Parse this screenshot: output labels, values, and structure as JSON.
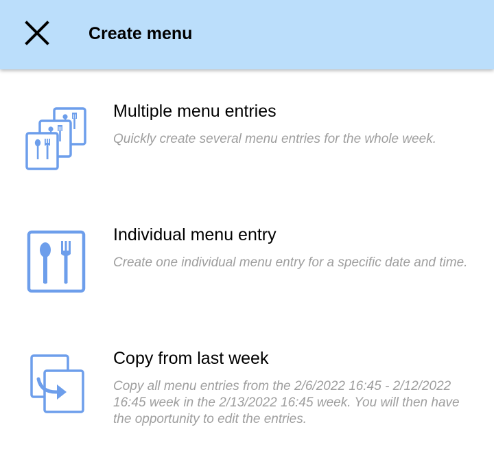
{
  "header": {
    "title": "Create menu",
    "close_icon": "close-icon"
  },
  "colors": {
    "header_bg": "#bbdefb",
    "icon_blue": "#6d9eeb",
    "description_text": "#9e9e9e"
  },
  "options": [
    {
      "title": "Multiple menu entries",
      "description": "Quickly create several menu entries for the whole week.",
      "icon": "multiple-cutlery-cards-icon"
    },
    {
      "title": "Individual menu entry",
      "description": "Create one individual menu entry for a specific date and time.",
      "icon": "cutlery-card-icon"
    },
    {
      "title": "Copy from last week",
      "description": "Copy all menu entries from the 2/6/2022 16:45 - 2/12/2022 16:45 week in the 2/13/2022 16:45 week. You will then have the opportunity to edit the entries.",
      "icon": "copy-arrow-icon"
    }
  ]
}
